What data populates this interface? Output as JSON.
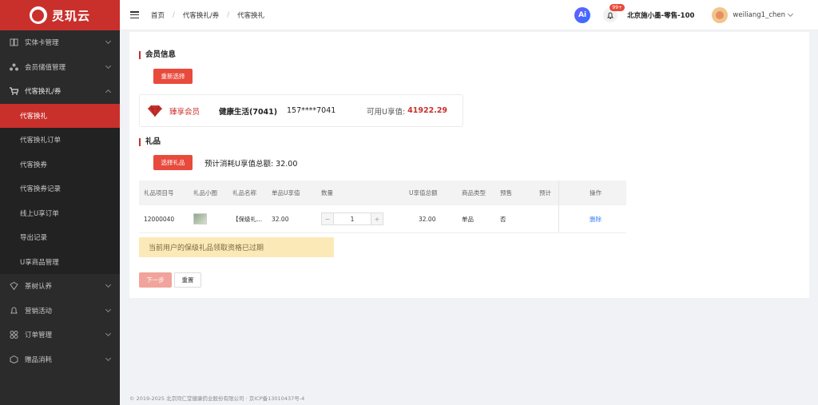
{
  "app": {
    "name": "灵玑云"
  },
  "sidebar": {
    "items": [
      {
        "label": "实体卡管理",
        "icon": "book-icon"
      },
      {
        "label": "会员储值管理",
        "icon": "users-icon"
      },
      {
        "label": "代客换礼/券",
        "icon": "cart-icon",
        "open": true,
        "children": [
          {
            "label": "代客换礼",
            "active": true
          },
          {
            "label": "代客换礼订单"
          },
          {
            "label": "代客换券"
          },
          {
            "label": "代客换券记录"
          },
          {
            "label": "线上U享订单"
          },
          {
            "label": "导出记录"
          },
          {
            "label": "U享商品管理"
          }
        ]
      },
      {
        "label": "茶树认养",
        "icon": "shield-icon"
      },
      {
        "label": "营销活动",
        "icon": "bell-icon"
      },
      {
        "label": "订单管理",
        "icon": "grid-icon"
      },
      {
        "label": "赠品消耗",
        "icon": "box-icon"
      }
    ]
  },
  "header": {
    "breadcrumb": [
      "首页",
      "代客换礼/券",
      "代客换礼"
    ],
    "ai_label": "Ai",
    "notification_badge": "99+",
    "store": "北京施小墨-零售-100",
    "username": "weiliang1_chen"
  },
  "member": {
    "section_title": "会员信息",
    "reselect_label": "重新选择",
    "tier": "臻享会员",
    "shop": "健康生活(7041)",
    "phone": "157****7041",
    "available_label": "可用U享值:",
    "available_value": "41922.29"
  },
  "gift": {
    "section_title": "礼品",
    "select_label": "选择礼品",
    "estimate": "预计消耗U享值总额: 32.00",
    "columns": [
      "礼品项目号",
      "礼品小图",
      "礼品名称",
      "单品U享值",
      "数量",
      "U享值总额",
      "商品类型",
      "预售",
      "预计",
      "操作"
    ],
    "rows": [
      {
        "item_no": "12000040",
        "name": "【保级礼...",
        "unit_value": "32.00",
        "qty": "1",
        "total": "32.00",
        "type": "单品",
        "presale": "否",
        "action": "删除"
      }
    ],
    "minus": "−",
    "plus": "+"
  },
  "warning": "当前用户的保级礼品领取资格已过期",
  "actions": {
    "next": "下一步",
    "reset": "重置"
  },
  "footer": "© 2019-2025 北京同仁堂健康药业股份有限公司 · 京ICP备13010437号-4",
  "colors": {
    "brand": "#c9302c",
    "button": "#e84a3c",
    "warning_bg": "#fbe9b8",
    "link": "#3b82f6"
  }
}
